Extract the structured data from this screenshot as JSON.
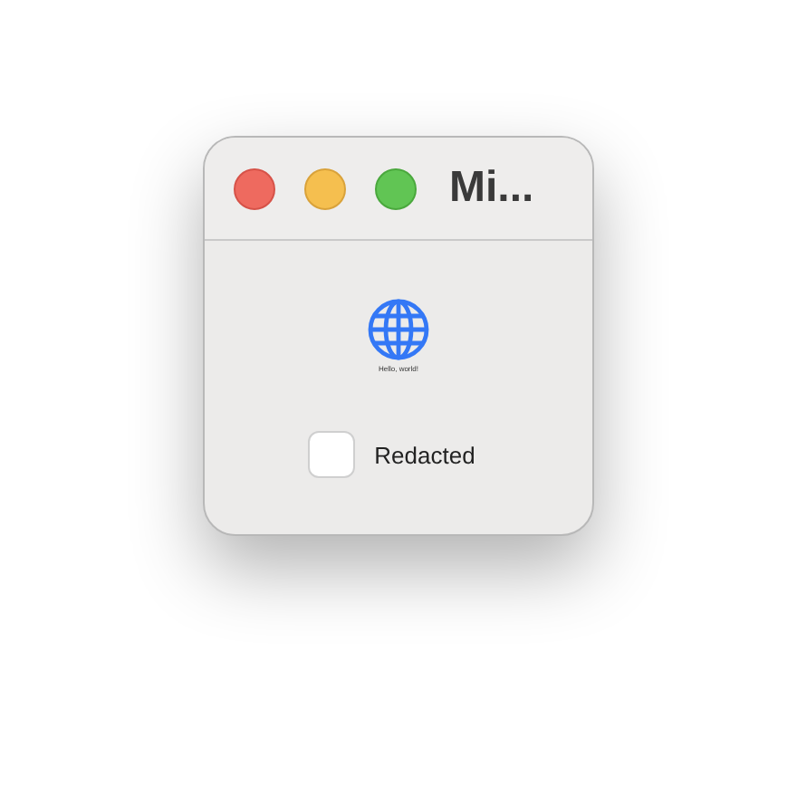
{
  "window": {
    "title": "Mi..."
  },
  "content": {
    "caption": "Hello, world!"
  },
  "checkbox": {
    "label": "Redacted",
    "checked": false
  }
}
